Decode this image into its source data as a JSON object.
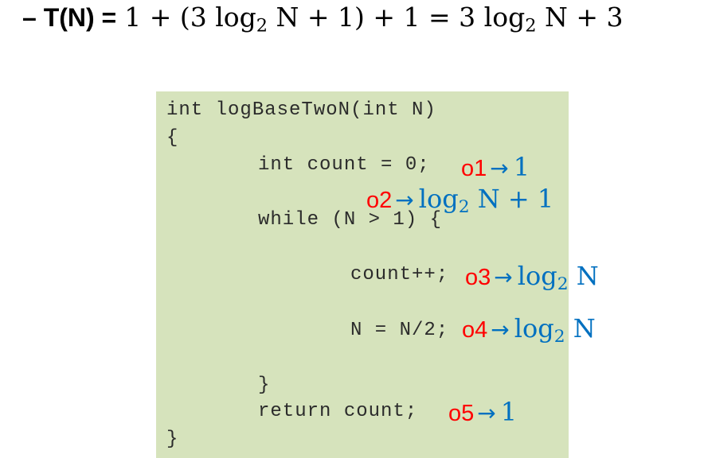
{
  "formula": {
    "lead": "– T(N) =",
    "expr_part1": "1 + (3 log",
    "expr_sub1": "2",
    "expr_part2": " N + 1) + 1 = 3 log",
    "expr_sub2": "2",
    "expr_part3": " N + 3"
  },
  "code": {
    "line_signature": "int logBaseTwoN(int N)",
    "line_open_brace": "{",
    "line_count_init": "int count = 0;",
    "line_while": "while (N > 1) {",
    "line_increment": "count++;",
    "line_halve": "N = N/2;",
    "line_inner_close": "}",
    "line_return": "return count;",
    "line_close_brace": "}"
  },
  "annotations": {
    "o1": {
      "op": "o1",
      "arrow": "→",
      "cost_main": "1",
      "cost_sub": "",
      "cost_tail": ""
    },
    "o2": {
      "op": "o2",
      "arrow": "→",
      "cost_main": "log",
      "cost_sub": "2",
      "cost_tail": " N + 1"
    },
    "o3": {
      "op": "o3",
      "arrow": "→",
      "cost_main": "log",
      "cost_sub": "2",
      "cost_tail": " N"
    },
    "o4": {
      "op": "o4",
      "arrow": "→",
      "cost_main": "log",
      "cost_sub": "2",
      "cost_tail": " N"
    },
    "o5": {
      "op": "o5",
      "arrow": "→",
      "cost_main": "1",
      "cost_sub": "",
      "cost_tail": ""
    }
  },
  "colors": {
    "code_background": "#d6e3bc",
    "operation_label": "#ff0000",
    "cost_label": "#0070c0"
  }
}
